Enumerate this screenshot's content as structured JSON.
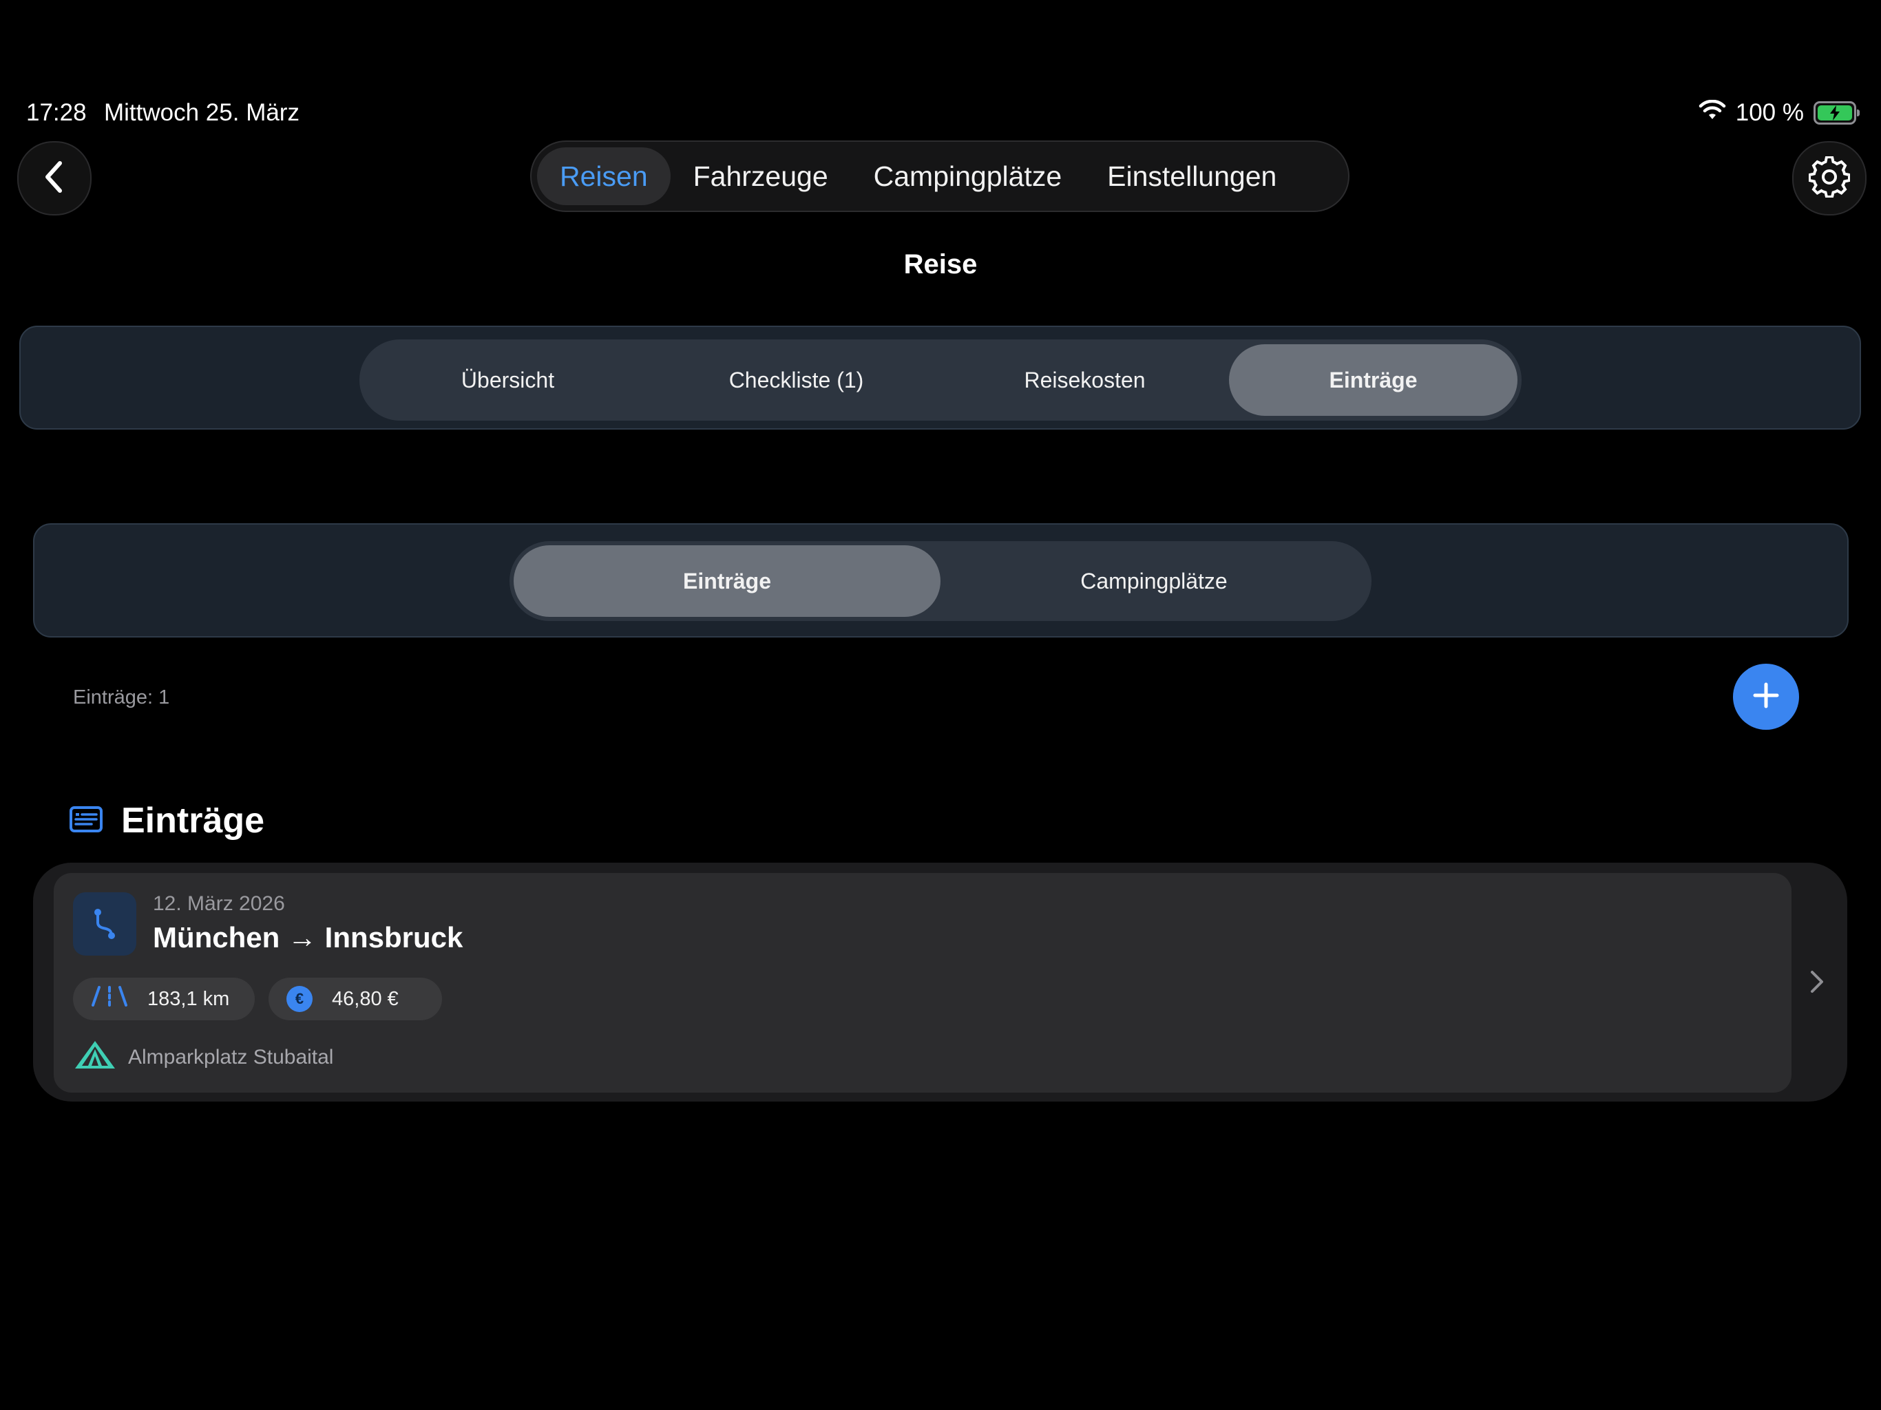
{
  "status": {
    "time": "17:28",
    "date": "Mittwoch 25. März",
    "battery": "100 %"
  },
  "top_nav": {
    "tabs": [
      "Reisen",
      "Fahrzeuge",
      "Campingplätze",
      "Einstellungen"
    ],
    "active": "Reisen"
  },
  "page_title": "Reise",
  "trip_tabs": {
    "items": [
      "Übersicht",
      "Checkliste (1)",
      "Reisekosten",
      "Einträge"
    ],
    "active": "Einträge"
  },
  "entry_tabs": {
    "items": [
      "Einträge",
      "Campingplätze"
    ],
    "active": "Einträge"
  },
  "count_label": "Einträge: 1",
  "section": {
    "title": "Einträge",
    "icon": "list-icon"
  },
  "entries": [
    {
      "date": "12. März 2026",
      "title": "München → Innsbruck",
      "distance": "183,1 km",
      "cost": "46,80 €",
      "campsite": "Almparkplatz Stubaital"
    }
  ],
  "colors": {
    "accent": "#3a85f0",
    "active_tab_text": "#4a9cf5",
    "battery": "#34c759",
    "tent": "#3fcfb4"
  }
}
